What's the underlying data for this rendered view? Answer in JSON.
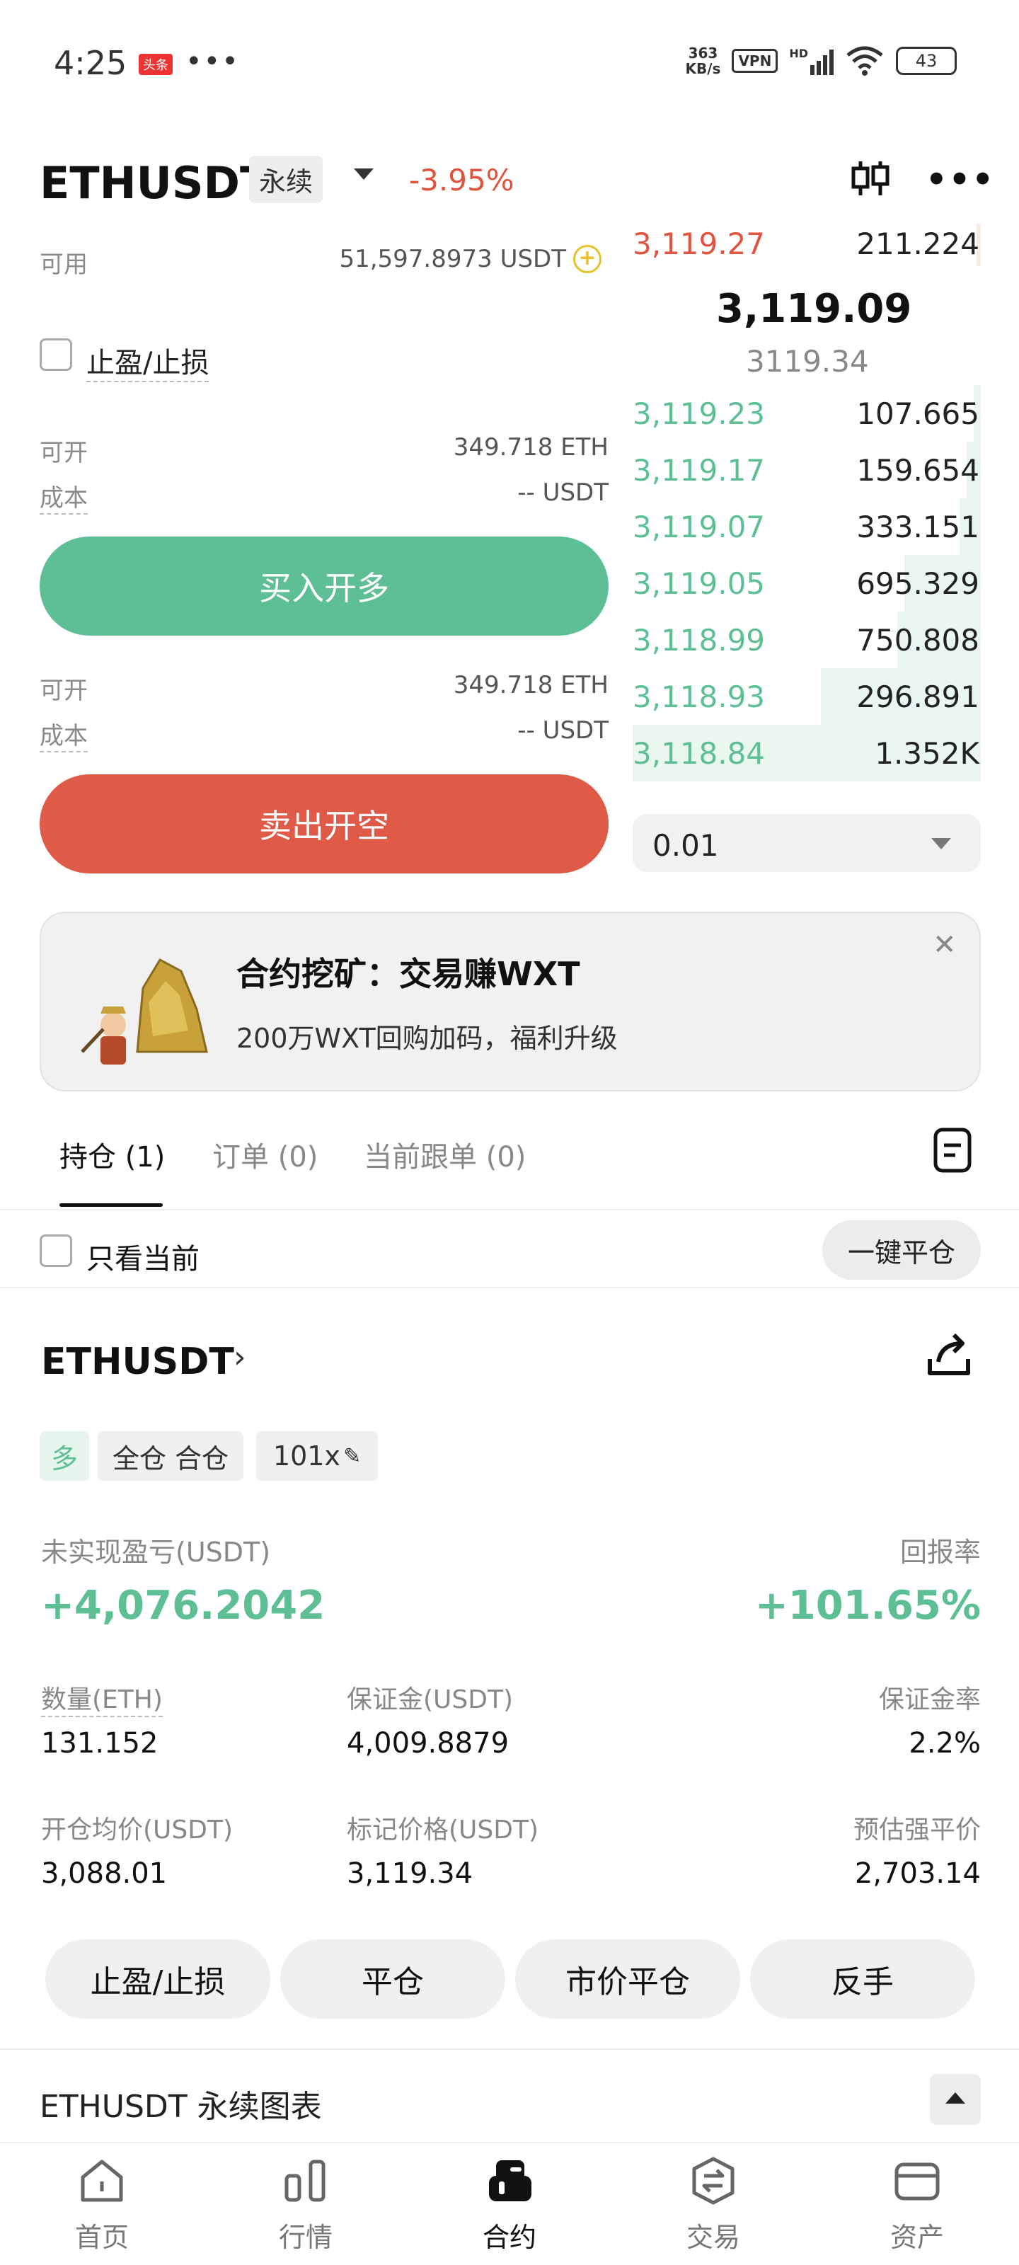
{
  "status_bar": {
    "time": "4:25",
    "badge": "头条",
    "dots": "•••",
    "net_speed_value": "363",
    "net_speed_unit": "KB/s",
    "vpn": "VPN",
    "hd": "HD",
    "battery": "43"
  },
  "header": {
    "pair": "ETHUSDT",
    "perp_tag": "永续",
    "change": "-3.95%"
  },
  "form": {
    "available_label": "可用",
    "available_value": "51,597.8973 USDT",
    "tpsl_label": "止盈/止损",
    "long": {
      "open_label": "可开",
      "open_value": "349.718 ETH",
      "cost_label": "成本",
      "cost_value": "-- USDT",
      "button": "买入开多"
    },
    "short": {
      "open_label": "可开",
      "open_value": "349.718 ETH",
      "cost_label": "成本",
      "cost_value": "-- USDT",
      "button": "卖出开空"
    }
  },
  "orderbook": {
    "asks": [
      {
        "price": "3,119.27",
        "qty": "211.224"
      }
    ],
    "last_price": "3,119.09",
    "mark_price": "3119.34",
    "bids": [
      {
        "price": "3,119.23",
        "qty": "107.665",
        "depth": 0.02
      },
      {
        "price": "3,119.17",
        "qty": "159.654",
        "depth": 0.04
      },
      {
        "price": "3,119.07",
        "qty": "333.151",
        "depth": 0.06
      },
      {
        "price": "3,119.05",
        "qty": "695.329",
        "depth": 0.22
      },
      {
        "price": "3,118.99",
        "qty": "750.808",
        "depth": 0.24
      },
      {
        "price": "3,118.93",
        "qty": "296.891",
        "depth": 0.46
      },
      {
        "price": "3,118.84",
        "qty": "1.352K",
        "depth": 1.0
      }
    ],
    "step": "0.01"
  },
  "banner": {
    "title": "合约挖矿：交易赚WXT",
    "subtitle": "200万WXT回购加码，福利升级"
  },
  "tabs": [
    {
      "label": "持仓 (1)"
    },
    {
      "label": "订单 (0)"
    },
    {
      "label": "当前跟单 (0)"
    }
  ],
  "filter": {
    "only_current": "只看当前",
    "close_all": "一键平仓"
  },
  "position": {
    "pair": "ETHUSDT",
    "side": "多",
    "mode": "全仓 合仓",
    "leverage": "101x",
    "pnl_label": "未实现盈亏(USDT)",
    "pnl_value": "+4,076.2042",
    "roe_label": "回报率",
    "roe_value": "+101.65%",
    "qty_label": "数量(ETH)",
    "qty_value": "131.152",
    "margin_label": "保证金(USDT)",
    "margin_value": "4,009.8879",
    "margin_ratio_label": "保证金率",
    "margin_ratio_value": "2.2%",
    "entry_label": "开仓均价(USDT)",
    "entry_value": "3,088.01",
    "mark_label": "标记价格(USDT)",
    "mark_value": "3,119.34",
    "liq_label": "预估强平价",
    "liq_value": "2,703.14",
    "actions": [
      "止盈/止损",
      "平仓",
      "市价平仓",
      "反手"
    ]
  },
  "chart_section": {
    "title": "ETHUSDT 永续图表"
  },
  "nav": [
    {
      "label": "首页",
      "icon": "home-icon"
    },
    {
      "label": "行情",
      "icon": "market-icon"
    },
    {
      "label": "合约",
      "icon": "futures-icon"
    },
    {
      "label": "交易",
      "icon": "trade-icon"
    },
    {
      "label": "资产",
      "icon": "wallet-icon"
    }
  ],
  "colors": {
    "green": "#5dbf93",
    "red": "#e0533f"
  }
}
